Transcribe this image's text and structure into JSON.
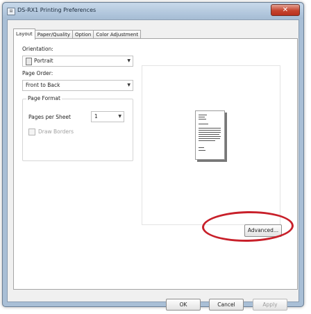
{
  "window": {
    "title": "DS-RX1 Printing Preferences",
    "close_symbol": "✕"
  },
  "tabs": [
    {
      "label": "Layout",
      "active": true
    },
    {
      "label": "Paper/Quality",
      "active": false
    },
    {
      "label": "Option",
      "active": false
    },
    {
      "label": "Color Adjustment",
      "active": false
    }
  ],
  "layout": {
    "orientation": {
      "label": "Orientation:",
      "value": "Portrait"
    },
    "page_order": {
      "label": "Page Order:",
      "value": "Front to Back"
    },
    "page_format": {
      "title": "Page Format",
      "pages_per_sheet_label": "Pages per Sheet",
      "pages_per_sheet_value": "1",
      "draw_borders_label": "Draw Borders",
      "draw_borders_checked": false,
      "draw_borders_enabled": false
    },
    "preview": {
      "orientation": "portrait"
    }
  },
  "advanced_button": {
    "label": "Advanced...",
    "highlighted": true,
    "highlight_color": "#c8202a"
  },
  "footer": {
    "ok_label": "OK",
    "cancel_label": "Cancel",
    "apply_label": "Apply",
    "apply_enabled": false
  },
  "icons": {
    "app": "printer-icon",
    "portrait": "portrait-page-icon",
    "dropdown": "chevron-down-icon"
  }
}
